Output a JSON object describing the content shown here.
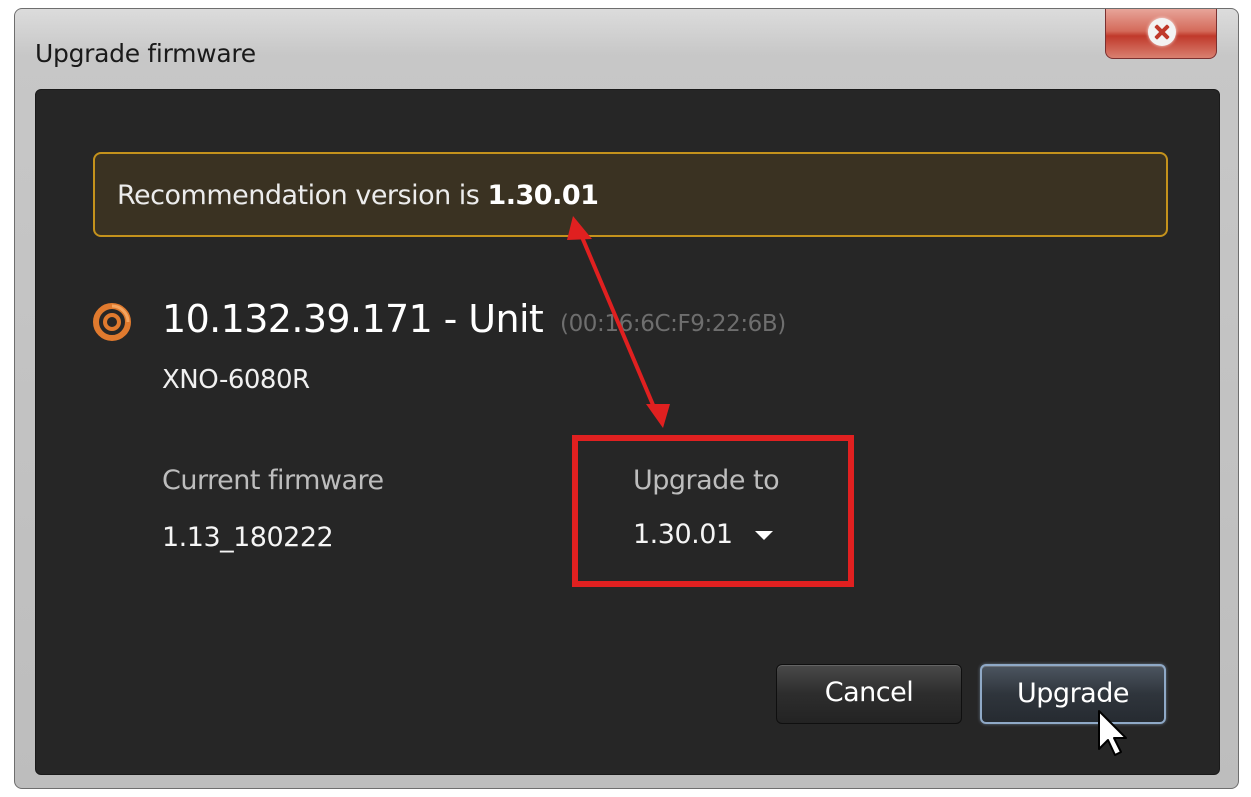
{
  "window": {
    "title": "Upgrade firmware"
  },
  "banner": {
    "prefix": "Recommendation version is ",
    "version": "1.30.01"
  },
  "device": {
    "name": "10.132.39.171 - Unit",
    "mac": "(00:16:6C:F9:22:6B)",
    "model": "XNO-6080R",
    "icon": "camera-unit-icon"
  },
  "firmware": {
    "current_label": "Current firmware",
    "current_value": "1.13_180222",
    "upgrade_label": "Upgrade to",
    "upgrade_value": "1.30.01"
  },
  "buttons": {
    "cancel": "Cancel",
    "upgrade": "Upgrade"
  },
  "colors": {
    "banner_border": "#c4921c",
    "highlight": "#e02020",
    "icon_orange": "#e07a2e"
  }
}
